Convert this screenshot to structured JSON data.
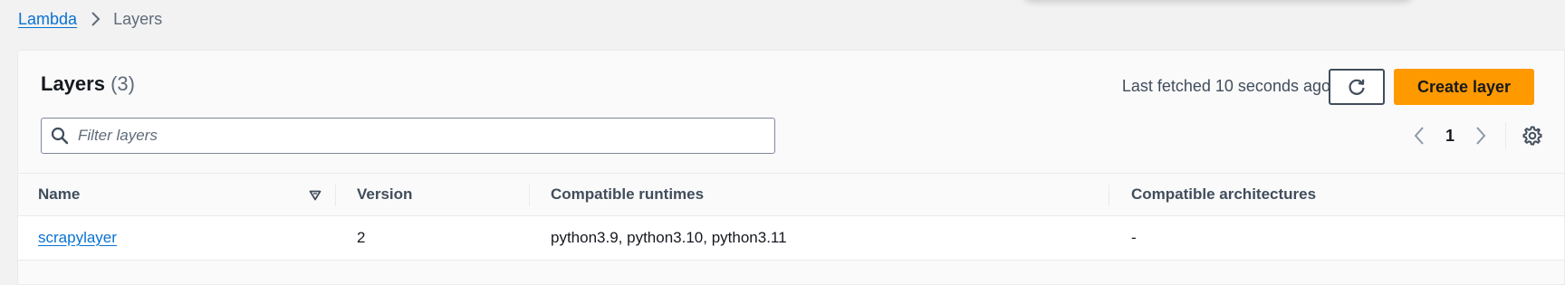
{
  "breadcrumb": {
    "root": "Lambda",
    "separator_icon": "chevron-right-icon",
    "current": "Layers"
  },
  "panel": {
    "title": "Layers",
    "count": "(3)",
    "last_fetched": "Last fetched 10 seconds ago",
    "refresh_icon": "refresh-icon",
    "create_button": "Create layer",
    "accent_color": "#ff9900",
    "link_color": "#0972d3"
  },
  "filter": {
    "placeholder": "Filter layers",
    "value": "",
    "icon": "search-icon"
  },
  "pagination": {
    "current_page": "1",
    "prev_icon": "chevron-left-icon",
    "next_icon": "chevron-right-icon",
    "settings_icon": "gear-icon"
  },
  "table": {
    "columns": [
      "Name",
      "Version",
      "Compatible runtimes",
      "Compatible architectures"
    ],
    "sort_icon": "sort-descending-icon",
    "rows": [
      {
        "name": "scrapylayer",
        "version": "2",
        "runtimes": "python3.9, python3.10, python3.11",
        "architectures": "-"
      }
    ]
  }
}
